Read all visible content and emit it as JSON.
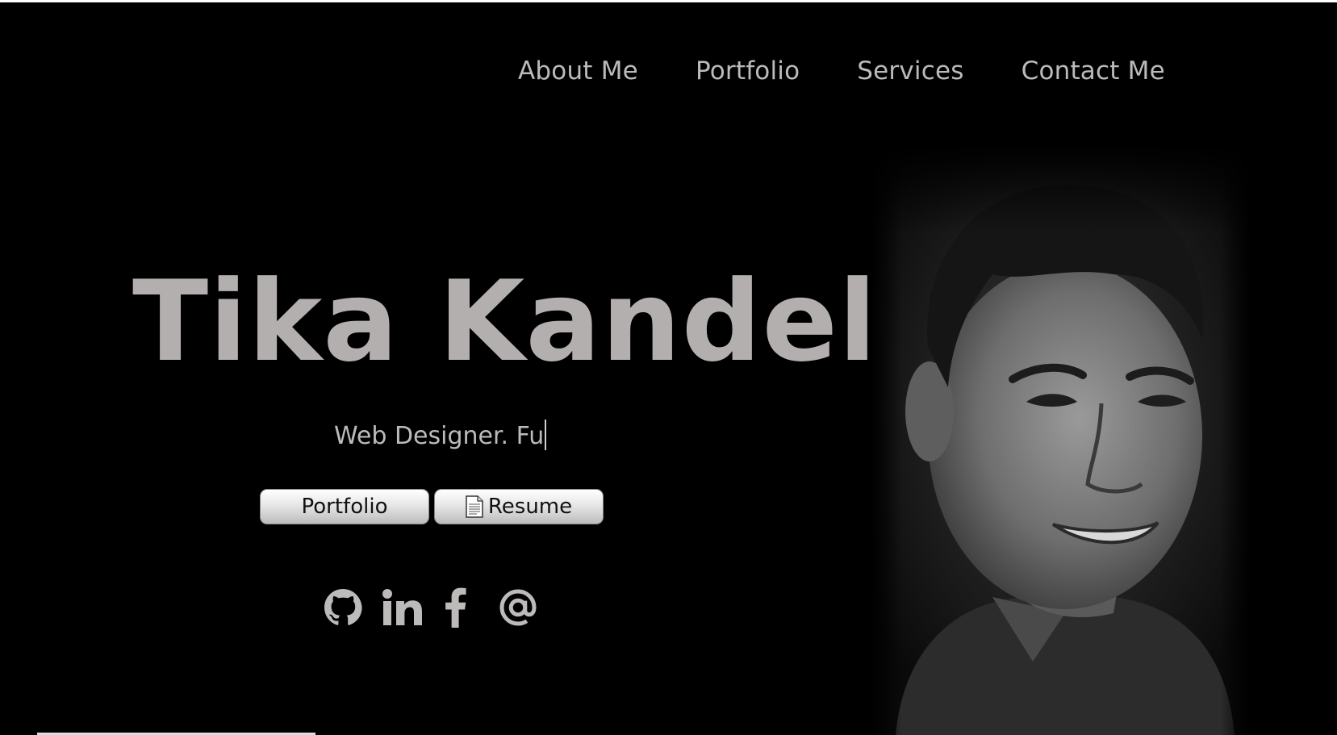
{
  "nav": {
    "items": [
      {
        "label": "About Me"
      },
      {
        "label": "Portfolio"
      },
      {
        "label": "Services"
      },
      {
        "label": "Contact Me"
      }
    ]
  },
  "hero": {
    "name": "Tika Kandel",
    "tagline": "Web Designer. Fu"
  },
  "buttons": {
    "portfolio_label": "Portfolio",
    "resume_label": "Resume",
    "resume_icon": "document-icon"
  },
  "social": {
    "icons": [
      "github-icon",
      "linkedin-icon",
      "facebook-icon",
      "email-at-icon"
    ]
  },
  "colors": {
    "background": "#000000",
    "text": "#bdbaba",
    "name": "#b3afaf"
  }
}
